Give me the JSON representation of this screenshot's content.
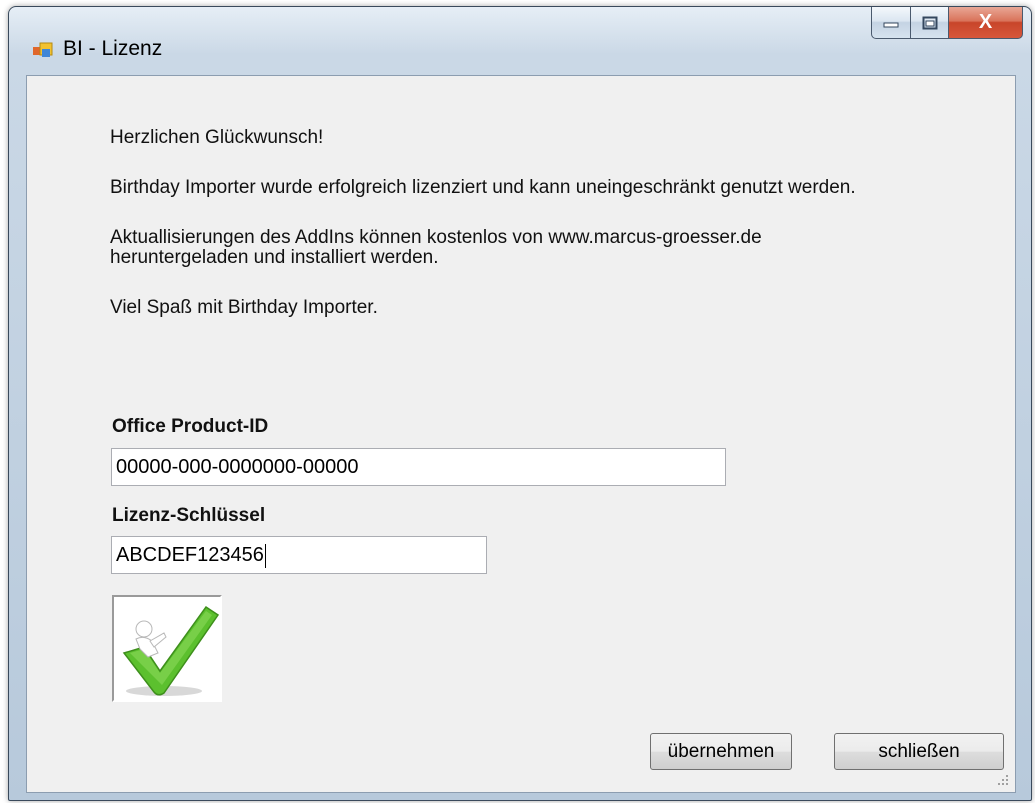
{
  "window": {
    "title": "BI - Lizenz",
    "close_glyph": "X"
  },
  "messages": {
    "congrats": "Herzlichen Glückwunsch!",
    "licensed": "Birthday Importer wurde erfolgreich lizenziert und kann uneingeschränkt genutzt werden.",
    "updates_line1": "Aktuallisierungen des AddIns können kostenlos von www.marcus-groesser.de",
    "updates_line2": "heruntergeladen und installiert werden.",
    "enjoy": "Viel Spaß mit Birthday Importer."
  },
  "form": {
    "product_id_label": "Office Product-ID",
    "product_id_value": "00000-000-0000000-00000",
    "license_key_label": "Lizenz-Schlüssel",
    "license_key_value": "ABCDEF123456"
  },
  "buttons": {
    "apply": "übernehmen",
    "close": "schließen"
  },
  "icons": {
    "app": "app-window-icon",
    "minimize": "minimize-icon",
    "maximize": "maximize-icon",
    "close": "close-icon",
    "success": "checkmark-figure-icon",
    "grip": "resize-grip-icon"
  },
  "colors": {
    "check_green": "#5cc02e",
    "close_red": "#c8452a"
  }
}
